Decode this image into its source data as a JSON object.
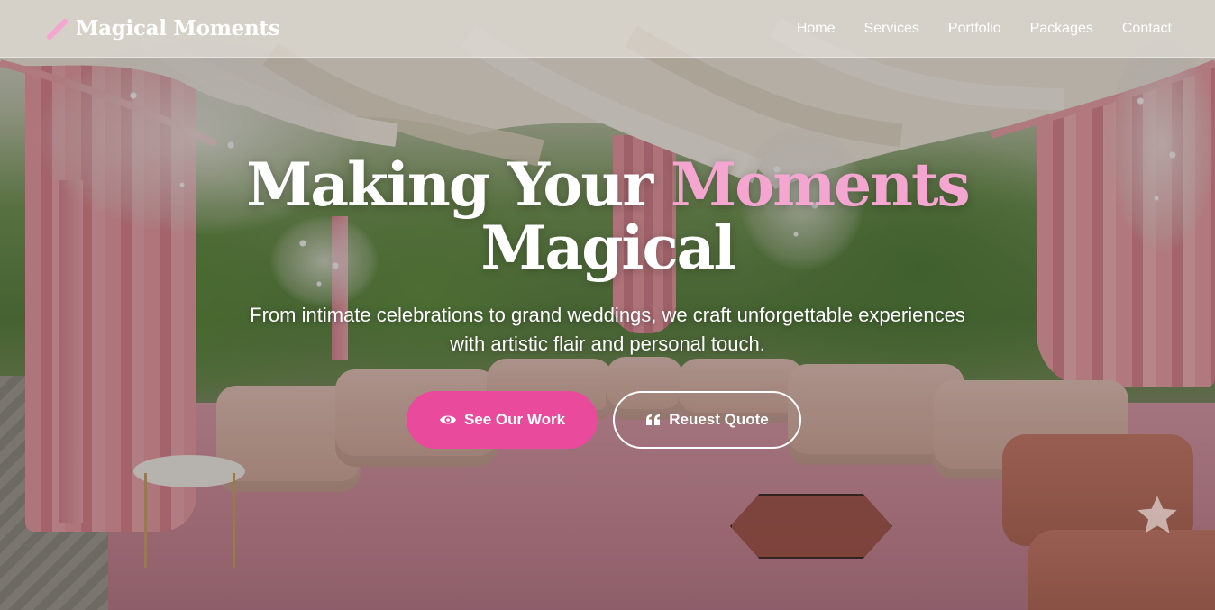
{
  "brand": {
    "name": "Magical Moments",
    "icon": "magic-wand-icon",
    "icon_color": "#f5a6d0"
  },
  "nav": {
    "items": [
      {
        "label": "Home"
      },
      {
        "label": "Services"
      },
      {
        "label": "Portfolio"
      },
      {
        "label": "Packages"
      },
      {
        "label": "Contact"
      }
    ]
  },
  "hero": {
    "title_line1_prefix": "Making Your ",
    "title_line1_accent": "Moments",
    "title_line2": "Magical",
    "subtitle": "From intimate celebrations to grand weddings, we craft unforgettable experiences with artistic flair and personal touch.",
    "primary_button": {
      "label": "See Our Work",
      "icon": "eye-icon"
    },
    "secondary_button": {
      "label": "Reuest Quote",
      "icon": "quote-icon"
    }
  },
  "floating_action": {
    "icon": "star-icon"
  },
  "colors": {
    "accent_pink": "#e94a9c",
    "title_accent": "#f5a6d0",
    "text": "#ffffff"
  }
}
